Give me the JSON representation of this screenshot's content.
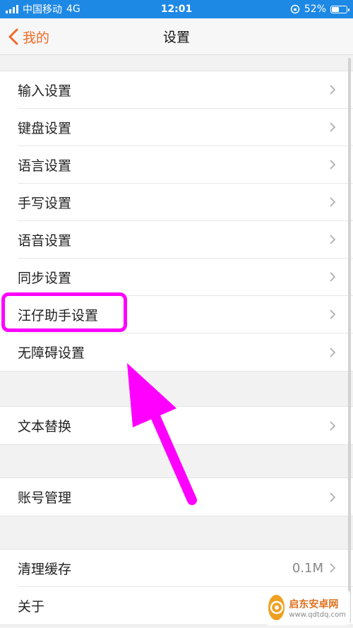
{
  "status_bar": {
    "carrier": "中国移动",
    "network": "4G",
    "time": "12:01",
    "battery_percent": "52%",
    "battery_level": 0.52
  },
  "nav": {
    "back_label": "我的",
    "title": "设置"
  },
  "groups": [
    {
      "items": [
        {
          "label": "输入设置"
        },
        {
          "label": "键盘设置"
        },
        {
          "label": "语言设置"
        },
        {
          "label": "手写设置"
        },
        {
          "label": "语音设置"
        },
        {
          "label": "同步设置"
        },
        {
          "label": "汪仔助手设置"
        },
        {
          "label": "无障碍设置"
        }
      ]
    },
    {
      "items": [
        {
          "label": "文本替换"
        }
      ]
    },
    {
      "items": [
        {
          "label": "账号管理"
        }
      ]
    },
    {
      "items": [
        {
          "label": "清理缓存",
          "value": "0.1M"
        },
        {
          "label": "关于"
        }
      ]
    }
  ],
  "watermark": {
    "title": "启东安卓网",
    "url": "www.qdtdq.com"
  },
  "colors": {
    "accent": "#f06a25",
    "status_bar": "#1e88e5",
    "highlight": "#ff00ff"
  }
}
